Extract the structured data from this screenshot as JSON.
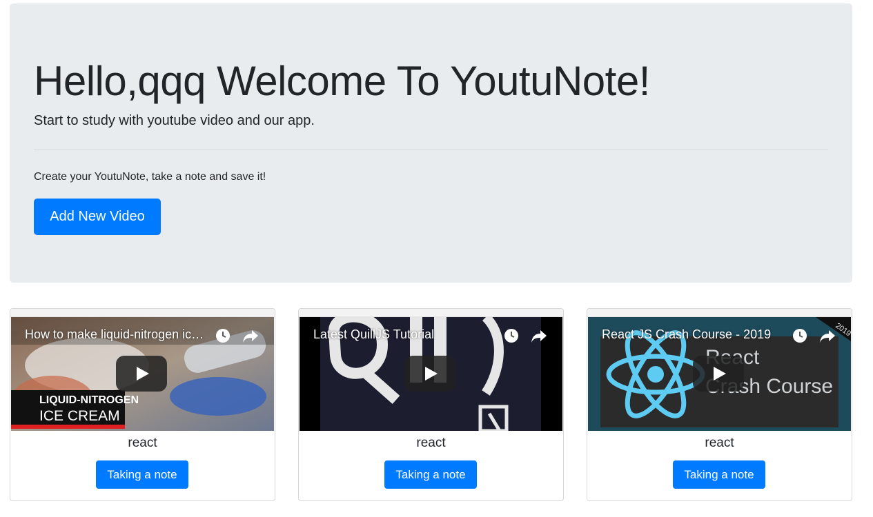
{
  "jumbotron": {
    "heading": "Hello,qqq Welcome To YoutuNote!",
    "lead": "Start to study with youtube video and our app.",
    "cta_text": "Create your YoutuNote, take a note and save it!",
    "add_button_label": "Add New Video"
  },
  "colors": {
    "primary": "#007bff",
    "jumbotron_bg": "#e9ecef"
  },
  "cards": [
    {
      "video_title": "How to make liquid-nitrogen ice cream",
      "thumb_caption_top": "LIQUID-NITROGEN",
      "thumb_caption_bottom": "ICE CREAM",
      "title": "react",
      "button_label": "Taking a note"
    },
    {
      "video_title": "Latest QuillJS Tutorial",
      "title": "react",
      "button_label": "Taking a note"
    },
    {
      "video_title": "React JS Crash Course - 2019",
      "thumb_text_1": "React",
      "thumb_text_2": "Crash Course",
      "thumb_corner": "2019",
      "title": "react",
      "button_label": "Taking a note"
    }
  ]
}
